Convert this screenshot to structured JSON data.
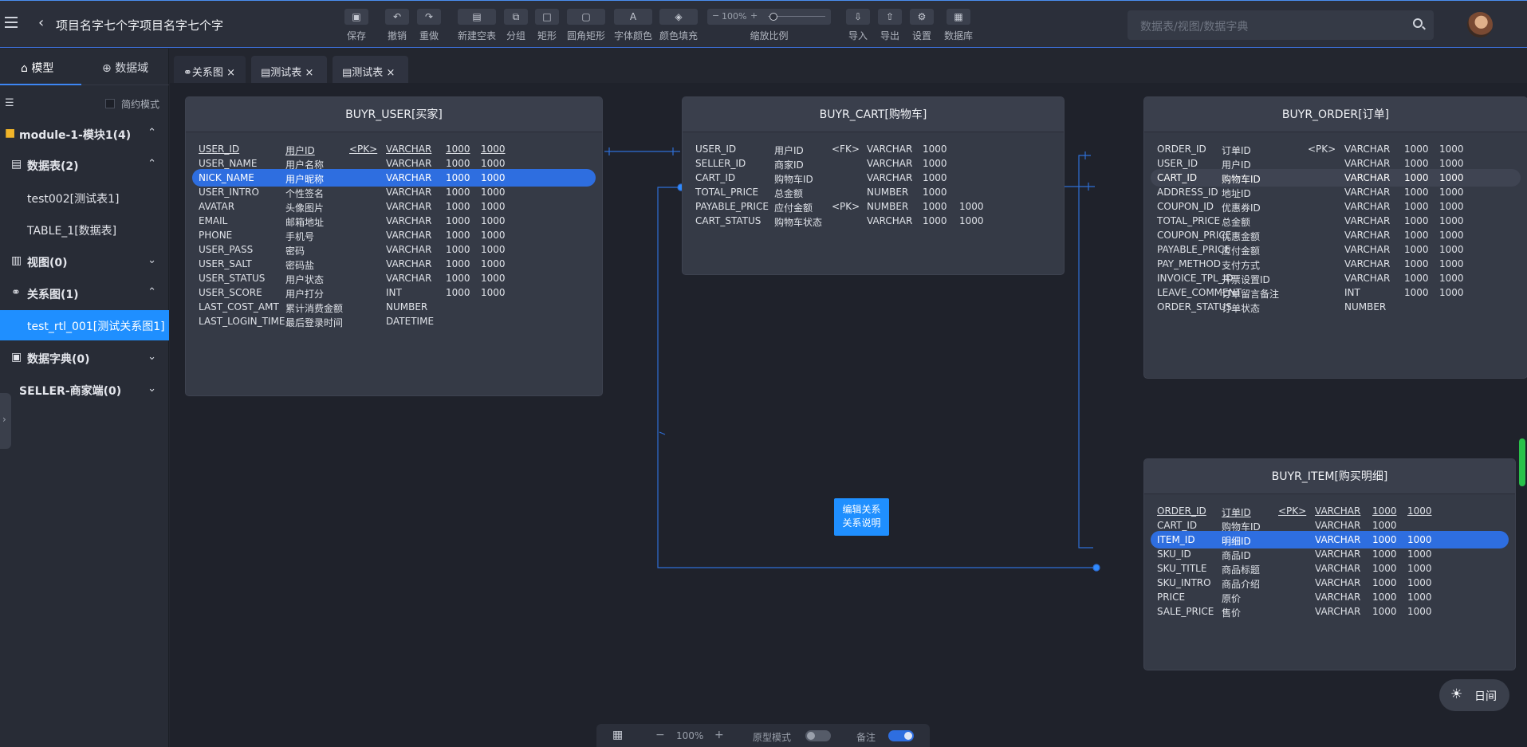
{
  "header": {
    "project_title": "项目名字七个字项目名字七个字",
    "search_placeholder": "数据表/视图/数据字典"
  },
  "toolbar": {
    "save": "保存",
    "undo": "撤销",
    "redo": "重做",
    "new_table": "新建空表",
    "group": "分组",
    "rect": "矩形",
    "round_rect": "圆角矩形",
    "font_color": "字体颜色",
    "fill_color": "颜色填充",
    "zoom_value": "100%",
    "zoom_label": "缩放比例",
    "import": "导入",
    "export": "导出",
    "settings": "设置",
    "database": "数据库"
  },
  "sidebar": {
    "tab_model": "模型",
    "tab_domain": "数据域",
    "simple_mode": "简约模式",
    "items": [
      {
        "label": "module-1-模块1(4)",
        "chevron": "^"
      },
      {
        "label": "数据表(2)",
        "chevron": "^"
      },
      {
        "label": "test002[测试表1]"
      },
      {
        "label": "TABLE_1[数据表]"
      },
      {
        "label": "视图(0)",
        "chevron": "v"
      },
      {
        "label": "关系图(1)",
        "chevron": "^"
      },
      {
        "label": "test_rtl_001[测试关系图1]"
      },
      {
        "label": "数据字典(0)",
        "chevron": "v"
      },
      {
        "label": "SELLER-商家端(0)",
        "chevron": "v"
      }
    ]
  },
  "tabs": [
    {
      "label": "关系图"
    },
    {
      "label": "测试表"
    },
    {
      "label": "测试表"
    }
  ],
  "tables": {
    "user": {
      "title": "BUYR_USER[买家]",
      "rows": [
        [
          "USER_ID",
          "用户ID",
          "<PK>",
          "VARCHAR",
          "1000",
          "1000"
        ],
        [
          "USER_NAME",
          "用户名称",
          "",
          "VARCHAR",
          "1000",
          "1000"
        ],
        [
          "NICK_NAME",
          "用户昵称",
          "",
          "VARCHAR",
          "1000",
          "1000"
        ],
        [
          "USER_INTRO",
          "个性签名",
          "",
          "VARCHAR",
          "1000",
          "1000"
        ],
        [
          "AVATAR",
          "头像图片",
          "",
          "VARCHAR",
          "1000",
          "1000"
        ],
        [
          "EMAIL",
          "邮箱地址",
          "",
          "VARCHAR",
          "1000",
          "1000"
        ],
        [
          "PHONE",
          "手机号",
          "",
          "VARCHAR",
          "1000",
          "1000"
        ],
        [
          "USER_PASS",
          "密码",
          "",
          "VARCHAR",
          "1000",
          "1000"
        ],
        [
          "USER_SALT",
          "密码盐",
          "",
          "VARCHAR",
          "1000",
          "1000"
        ],
        [
          "USER_STATUS",
          "用户状态",
          "",
          "VARCHAR",
          "1000",
          "1000"
        ],
        [
          "USER_SCORE",
          "用户打分",
          "",
          "INT",
          "1000",
          "1000"
        ],
        [
          "LAST_COST_AMT",
          "累计消费金额",
          "",
          "NUMBER",
          "",
          ""
        ],
        [
          "LAST_LOGIN_TIME",
          "最后登录时间",
          "",
          "DATETIME",
          "",
          ""
        ]
      ]
    },
    "cart": {
      "title": "BUYR_CART[购物车]",
      "rows": [
        [
          "USER_ID",
          "用户ID",
          "<FK>",
          "VARCHAR",
          "1000",
          ""
        ],
        [
          "SELLER_ID",
          "商家ID",
          "",
          "VARCHAR",
          "1000",
          ""
        ],
        [
          "CART_ID",
          "购物车ID",
          "",
          "VARCHAR",
          "1000",
          ""
        ],
        [
          "TOTAL_PRICE",
          "总金额",
          "",
          "NUMBER",
          "1000",
          ""
        ],
        [
          "PAYABLE_PRICE",
          "应付金额",
          "<PK>",
          "NUMBER",
          "1000",
          "1000"
        ],
        [
          "CART_STATUS",
          "购物车状态",
          "",
          "VARCHAR",
          "1000",
          "1000"
        ]
      ]
    },
    "order": {
      "title": "BUYR_ORDER[订单]",
      "rows": [
        [
          "ORDER_ID",
          "订单ID",
          "<PK>",
          "VARCHAR",
          "1000",
          "1000"
        ],
        [
          "USER_ID",
          "用户ID",
          "",
          "VARCHAR",
          "1000",
          "1000"
        ],
        [
          "CART_ID",
          "购物车ID",
          "",
          "VARCHAR",
          "1000",
          "1000"
        ],
        [
          "ADDRESS_ID",
          "地址ID",
          "",
          "VARCHAR",
          "1000",
          "1000"
        ],
        [
          "COUPON_ID",
          "优惠券ID",
          "",
          "VARCHAR",
          "1000",
          "1000"
        ],
        [
          "TOTAL_PRICE",
          "总金额",
          "",
          "VARCHAR",
          "1000",
          "1000"
        ],
        [
          "COUPON_PRICE",
          "优惠金额",
          "",
          "VARCHAR",
          "1000",
          "1000"
        ],
        [
          "PAYABLE_PRICE",
          "应付金额",
          "",
          "VARCHAR",
          "1000",
          "1000"
        ],
        [
          "PAY_METHOD",
          "支付方式",
          "",
          "VARCHAR",
          "1000",
          "1000"
        ],
        [
          "INVOICE_TPL_ID",
          "开票设置ID",
          "",
          "VARCHAR",
          "1000",
          "1000"
        ],
        [
          "LEAVE_COMMENT",
          "订单留言备注",
          "",
          "INT",
          "1000",
          "1000"
        ],
        [
          "ORDER_STATUS",
          "订单状态",
          "",
          "NUMBER",
          "",
          ""
        ]
      ]
    },
    "item": {
      "title": "BUYR_ITEM[购买明细]",
      "rows": [
        [
          "ORDER_ID",
          "订单ID",
          "<PK>",
          "VARCHAR",
          "1000",
          "1000"
        ],
        [
          "CART_ID",
          "购物车ID",
          "",
          "VARCHAR",
          "1000",
          ""
        ],
        [
          "ITEM_ID",
          "明细ID",
          "",
          "VARCHAR",
          "1000",
          "1000"
        ],
        [
          "SKU_ID",
          "商品ID",
          "",
          "VARCHAR",
          "1000",
          "1000"
        ],
        [
          "SKU_TITLE",
          "商品标题",
          "",
          "VARCHAR",
          "1000",
          "1000"
        ],
        [
          "SKU_INTRO",
          "商品介绍",
          "",
          "VARCHAR",
          "1000",
          "1000"
        ],
        [
          "PRICE",
          "原价",
          "",
          "VARCHAR",
          "1000",
          "1000"
        ],
        [
          "SALE_PRICE",
          "售价",
          "",
          "VARCHAR",
          "1000",
          "1000"
        ]
      ]
    }
  },
  "note": {
    "line1": "编辑关系",
    "line2": "关系说明"
  },
  "bottombar": {
    "zoom": "100%",
    "prototype": "原型模式",
    "remark": "备注"
  },
  "daymode": {
    "label": "日间"
  }
}
